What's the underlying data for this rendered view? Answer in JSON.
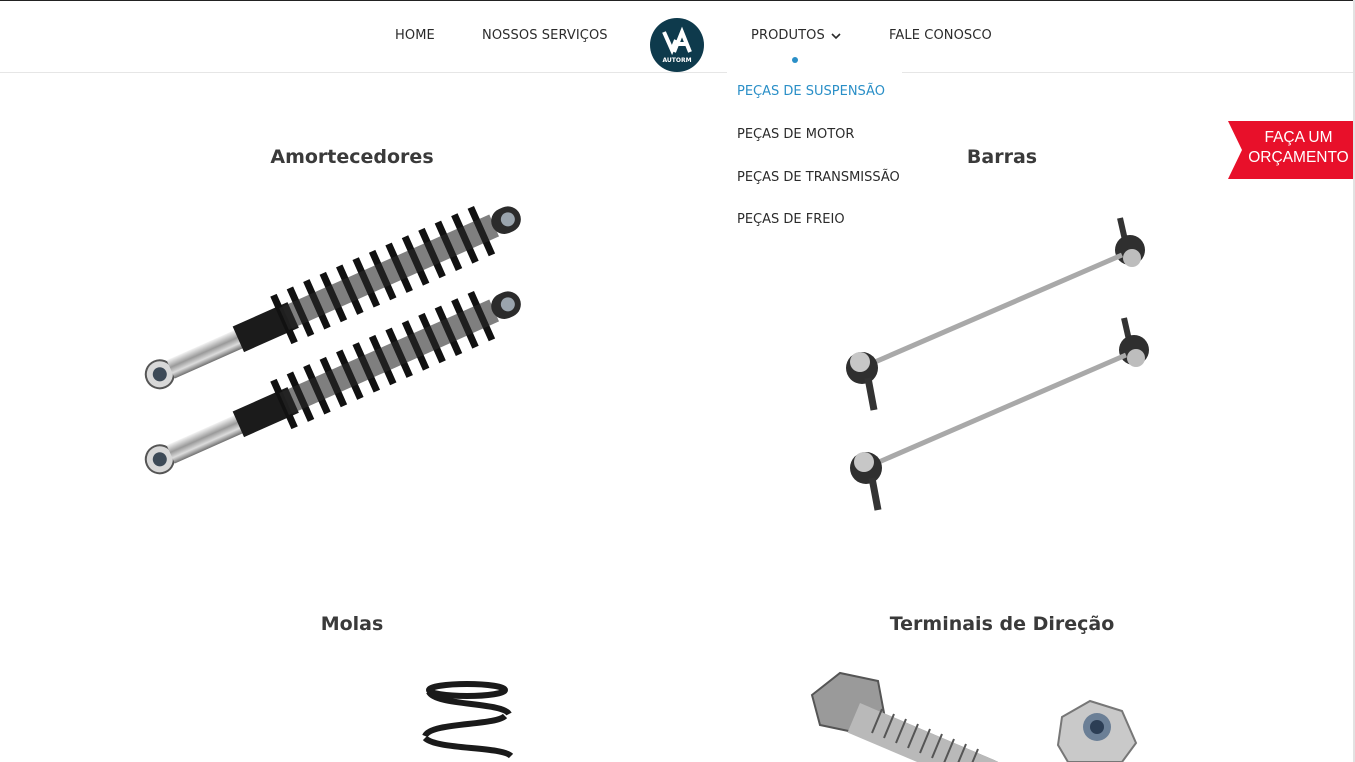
{
  "nav": {
    "home": "HOME",
    "services": "NOSSOS SERVIÇOS",
    "products": "PRODUTOS",
    "contact": "FALE CONOSCO"
  },
  "logo": {
    "text": "AUTORM"
  },
  "dropdown": {
    "items": [
      {
        "label": "PEÇAS DE SUSPENSÃO",
        "active": true
      },
      {
        "label": "PEÇAS DE MOTOR"
      },
      {
        "label": "PEÇAS DE TRANSMISSÃO"
      },
      {
        "label": "PEÇAS DE FREIO"
      }
    ]
  },
  "products": [
    {
      "title": "Amortecedores"
    },
    {
      "title": "Barras"
    },
    {
      "title": "Molas"
    },
    {
      "title": "Terminais de Direção"
    }
  ],
  "cta": {
    "line1": "FAÇA UM",
    "line2": "ORÇAMENTO"
  },
  "colors": {
    "accent": "#2a8fc7",
    "cta_red": "#e8102a",
    "logo_bg": "#0e3a4c"
  }
}
